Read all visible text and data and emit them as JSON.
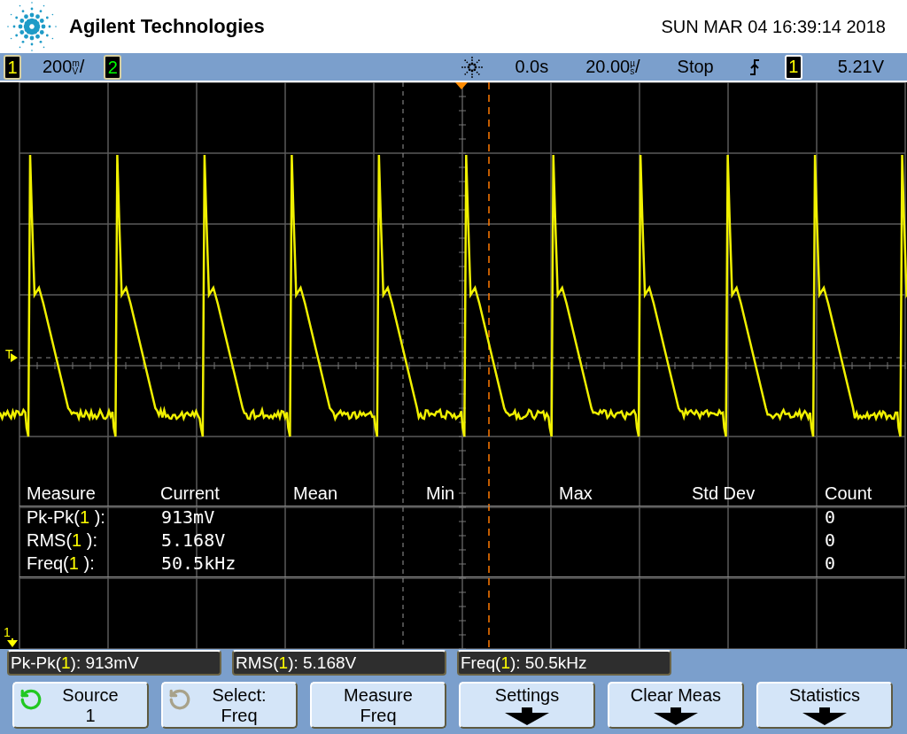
{
  "header": {
    "brand": "Agilent Technologies",
    "datetime": "SUN MAR 04 16:39:14 2018"
  },
  "status_bar": {
    "channels": [
      {
        "number": "1",
        "color": "#ffff00",
        "scale": "200",
        "unit_top": "m",
        "unit_bottom": "V",
        "slash": "/"
      },
      {
        "number": "2",
        "color": "#00ff00"
      }
    ],
    "delay": "0.0s",
    "timebase": {
      "value": "20.00",
      "unit_top": "µ",
      "unit_bottom": "s",
      "slash": "/"
    },
    "run_state": "Stop",
    "trigger": {
      "source": "1",
      "level": "5.21V"
    }
  },
  "graticule": {
    "trigger_marker": "T",
    "ground_marker": "1",
    "measurements": {
      "columns": [
        "Measure",
        "Current",
        "Mean",
        "Min",
        "Max",
        "Std Dev",
        "Count"
      ],
      "rows": [
        {
          "prefix": "Pk-Pk(",
          "source": "1",
          "suffix": " ):",
          "current": "913mV",
          "count": "0"
        },
        {
          "prefix": "RMS(",
          "source": "1",
          "suffix": " ):",
          "current": "5.168V",
          "count": "0"
        },
        {
          "prefix": "Freq(",
          "source": "1",
          "suffix": " ):",
          "current": "50.5kHz",
          "count": "0"
        }
      ]
    }
  },
  "readouts": [
    {
      "prefix": "Pk-Pk(",
      "source": "1",
      "suffix": " ): 913mV"
    },
    {
      "prefix": "RMS(",
      "source": "1",
      "suffix": " ): 5.168V"
    },
    {
      "prefix": "Freq(",
      "source": "1",
      "suffix": " ): 50.5kHz"
    }
  ],
  "softkeys": [
    {
      "kind": "knob",
      "knob_active": true,
      "label": "Source",
      "value": "1"
    },
    {
      "kind": "knob",
      "knob_active": false,
      "label": "Select:",
      "value": "Freq"
    },
    {
      "kind": "plain",
      "label": "Measure",
      "value": "Freq"
    },
    {
      "kind": "submenu",
      "label": "Settings"
    },
    {
      "kind": "submenu",
      "label": "Clear Meas"
    },
    {
      "kind": "submenu",
      "label": "Statistics"
    }
  ]
}
